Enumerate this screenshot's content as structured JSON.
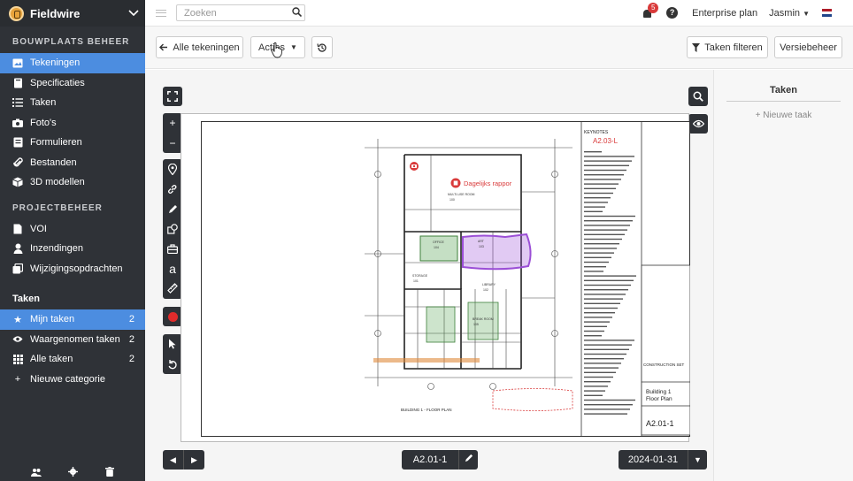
{
  "app": {
    "name": "Fieldwire"
  },
  "sidebar": {
    "section1_title": "BOUWPLAATS BEHEER",
    "section1_items": [
      {
        "label": "Tekeningen",
        "icon": "image-icon",
        "active": true
      },
      {
        "label": "Specificaties",
        "icon": "book-icon"
      },
      {
        "label": "Taken",
        "icon": "list-icon"
      },
      {
        "label": "Foto's",
        "icon": "camera-icon"
      },
      {
        "label": "Formulieren",
        "icon": "form-icon"
      },
      {
        "label": "Bestanden",
        "icon": "paperclip-icon"
      },
      {
        "label": "3D modellen",
        "icon": "cube-icon"
      }
    ],
    "section2_title": "PROJECTBEHEER",
    "section2_items": [
      {
        "label": "VOI",
        "icon": "document-icon"
      },
      {
        "label": "Inzendingen",
        "icon": "person-icon"
      },
      {
        "label": "Wijzigingsopdrachten",
        "icon": "copy-icon"
      }
    ],
    "tasks_title": "Taken",
    "task_items": [
      {
        "label": "Mijn taken",
        "icon": "star-icon",
        "count": "2",
        "active": true
      },
      {
        "label": "Waargenomen taken",
        "icon": "eye-icon",
        "count": "2"
      },
      {
        "label": "Alle taken",
        "icon": "grid-icon",
        "count": "2"
      },
      {
        "label": "Nieuwe categorie",
        "icon": "plus-icon",
        "count": ""
      }
    ]
  },
  "topbar": {
    "search_placeholder": "Zoeken",
    "notifications_count": "5",
    "plan": "Enterprise plan",
    "user": "Jasmin",
    "flag_colors": [
      "#ae1c28",
      "#ffffff",
      "#21468b"
    ]
  },
  "toolbar": {
    "back_label": "Alle tekeningen",
    "actions_label": "Acties",
    "filter_label": "Taken filteren",
    "version_label": "Versiebeheer"
  },
  "viewer": {
    "sheet_name": "A2.01-1",
    "date": "2024-01-31",
    "annotation_label": "Dagelijks rappor",
    "sheet_title_lines": [
      "Building 1",
      "Floor Plan"
    ],
    "sheet_number": "A2.01-1",
    "keynote_code": "A2.03-L",
    "keynotes_header": "KEYNOTES",
    "plan_label": "BUILDING 1 - FLOOR PLAN",
    "construction_set": "CONSTRUCTION SET",
    "room_labels": [
      "MULTI-USE ROOM",
      "STORAGE",
      "LIBRARY",
      "ART",
      "OFFICE",
      "BREAK ROOM"
    ],
    "room_numbers": [
      "100",
      "101",
      "102",
      "103",
      "104",
      "105"
    ]
  },
  "tasks_panel": {
    "title": "Taken",
    "new_task": "+ Nieuwe taak"
  },
  "colors": {
    "sidebar_bg": "#2f3237",
    "accent": "#4c8de0",
    "badge": "#d93a3a",
    "markup_red": "#d93a3a",
    "markup_purple": "#9b4fd6",
    "markup_green": "#5aa457",
    "markup_orange": "#e08a3c"
  }
}
